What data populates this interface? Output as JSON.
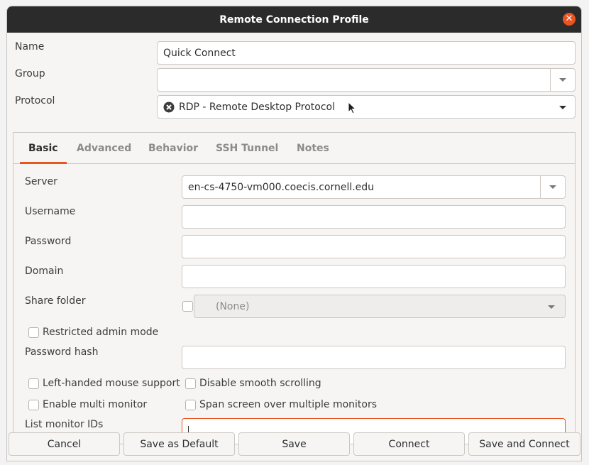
{
  "window": {
    "title": "Remote Connection Profile",
    "accent": "#e95420"
  },
  "labels": {
    "name": "Name",
    "group": "Group",
    "protocol": "Protocol"
  },
  "fields": {
    "name_value": "Quick Connect",
    "group_value": "",
    "protocol_value": "RDP - Remote Desktop Protocol",
    "protocol_icon": "rdp-icon"
  },
  "tabs": [
    {
      "label": "Basic"
    },
    {
      "label": "Advanced"
    },
    {
      "label": "Behavior"
    },
    {
      "label": "SSH Tunnel"
    },
    {
      "label": "Notes"
    }
  ],
  "basic": {
    "server_label": "Server",
    "server_value": "en-cs-4750-vm000.coecis.cornell.edu",
    "username_label": "Username",
    "password_label": "Password",
    "domain_label": "Domain",
    "share_folder_label": "Share folder",
    "share_folder_value": "(None)",
    "restricted_admin_label": "Restricted admin mode",
    "password_hash_label": "Password hash",
    "left_handed_label": "Left-handed mouse support",
    "disable_smooth_label": "Disable smooth scrolling",
    "enable_multi_label": "Enable multi monitor",
    "span_screen_label": "Span screen over multiple monitors",
    "list_monitor_label": "List monitor IDs"
  },
  "buttons": {
    "cancel": "Cancel",
    "save_default": "Save as Default",
    "save": "Save",
    "connect": "Connect",
    "save_connect": "Save and Connect"
  }
}
